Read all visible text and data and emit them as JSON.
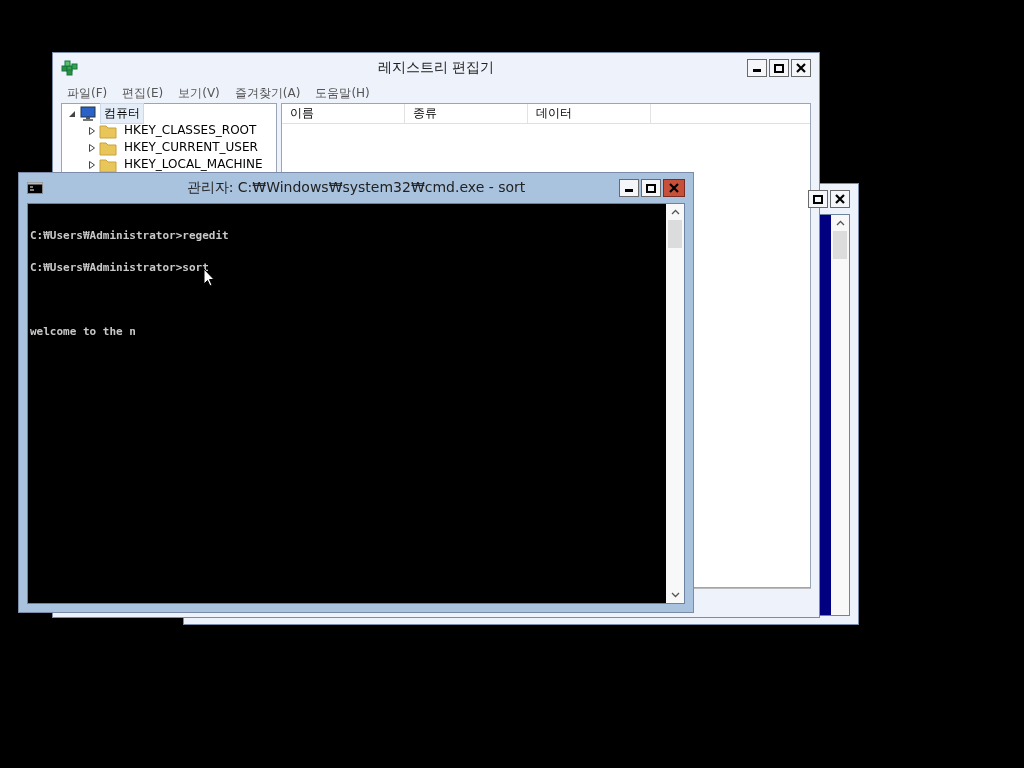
{
  "regedit": {
    "title": "레지스트리 편집기",
    "menu": [
      "파일(F)",
      "편집(E)",
      "보기(V)",
      "즐겨찾기(A)",
      "도움말(H)"
    ],
    "tree": [
      {
        "label": "컴퓨터",
        "expanded": true,
        "selected": true,
        "children": [
          {
            "label": "HKEY_CLASSES_ROOT",
            "expanded": false,
            "selected": false
          },
          {
            "label": "HKEY_CURRENT_USER",
            "expanded": false,
            "selected": false
          },
          {
            "label": "HKEY_LOCAL_MACHINE",
            "expanded": false,
            "selected": false
          }
        ]
      }
    ],
    "columns": [
      "이름",
      "종류",
      "데이터"
    ]
  },
  "cmd": {
    "title": "관리자: C:₩Windows₩system32₩cmd.exe - sort",
    "active": true,
    "output": "\nC:₩Users₩Administrator>regedit\n\nC:₩Users₩Administrator>sort\n\n\n\nwelcome to the n"
  }
}
